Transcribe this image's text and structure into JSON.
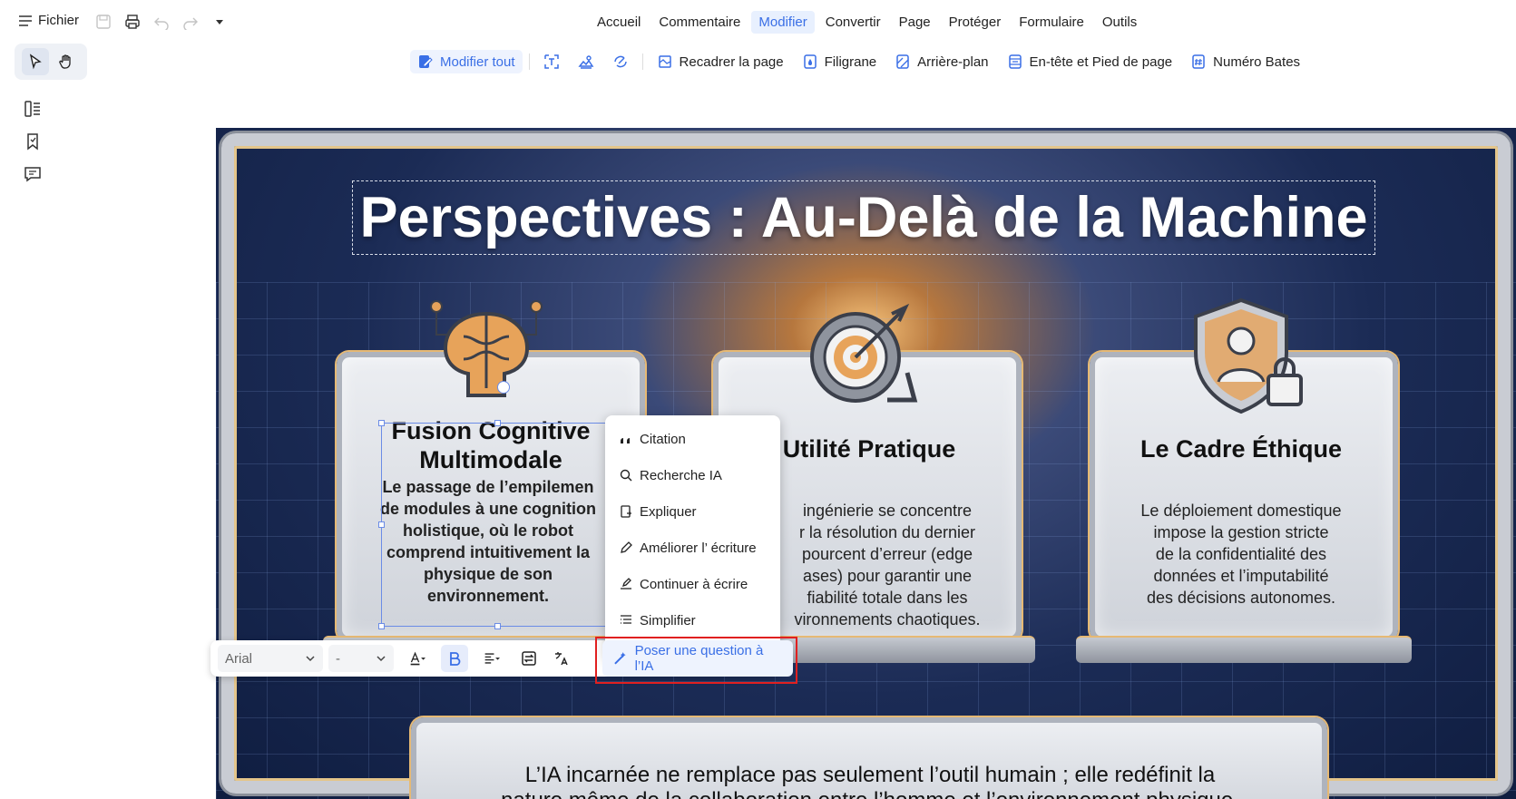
{
  "top": {
    "file_label": "Fichier",
    "menu": [
      "Accueil",
      "Commentaire",
      "Modifier",
      "Convertir",
      "Page",
      "Protéger",
      "Formulaire",
      "Outils"
    ],
    "active_menu": "Modifier"
  },
  "ribbon": {
    "edit_all": "Modifier tout",
    "crop": "Recadrer la page",
    "watermark": "Filigrane",
    "background": "Arrière-plan",
    "header_footer": "En-tête et Pied de page",
    "bates": "Numéro Bates"
  },
  "slide": {
    "title": "Perspectives : Au-Delà de la Machine",
    "panel1_title_l1": "Fusion Cognitive",
    "panel1_title_l2": "Multimodale",
    "panel1_body": [
      "Le passage de l’empilemen",
      "de modules à une cognition",
      "holistique, où le robot",
      "comprend intuitivement la",
      "physique de son",
      "environnement."
    ],
    "panel2_title": "Utilité Pratique",
    "panel2_body": [
      "ingénierie se concentre",
      "r la résolution du dernier",
      "pourcent d’erreur (edge",
      "ases) pour garantir une",
      "fiabilité totale dans les",
      "vironnements chaotiques."
    ],
    "panel3_title": "Le Cadre Éthique",
    "panel3_body": [
      "Le déploiement domestique",
      "impose la gestion stricte",
      "de la confidentialité des",
      "données et l’imputabilité",
      "des décisions autonomes."
    ],
    "bottom_l1": "L’IA incarnée ne remplace pas seulement l’outil humain ; elle redéfinit la",
    "bottom_l2": "nature même de la collaboration entre l’homme et l’environnement physique."
  },
  "format_bar": {
    "font": "Arial",
    "size": "-"
  },
  "context_menu": {
    "items": [
      "Citation",
      "Recherche IA",
      "Expliquer",
      "Améliorer l’  écriture",
      "Continuer à écrire",
      "Simplifier"
    ],
    "ask_ai": "Poser une question à l’IA"
  },
  "colors": {
    "accent": "#3a6fe6",
    "highlight": "#e02020"
  }
}
